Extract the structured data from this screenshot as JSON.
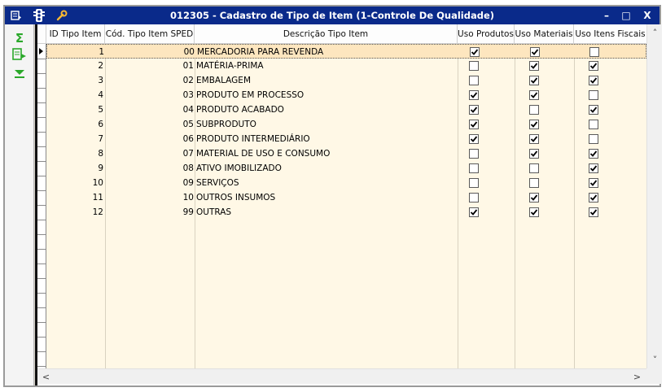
{
  "window": {
    "title": "012305 - Cadastro de Tipo de Item (1-Controle De Qualidade)",
    "minimize_glyph": "–",
    "maximize_glyph": "□",
    "close_glyph": "X"
  },
  "colors": {
    "titlebar": "#0a2a8a",
    "grid_body": "#fff8e6",
    "selected_row": "#fde6bf",
    "toolbar_icon": "#2aa82a"
  },
  "toolbar": {
    "icons": [
      "menu-icon",
      "traffic-light-icon",
      "wrench-icon"
    ],
    "side_icons": [
      "sigma-icon",
      "export-icon",
      "filter-icon"
    ]
  },
  "grid": {
    "columns": [
      "ID Tipo Item",
      "Cód. Tipo Item SPED",
      "Descrição Tipo Item",
      "Uso Produtos",
      "Uso Materiais",
      "Uso Itens Fiscais"
    ],
    "rows": [
      {
        "id": "1",
        "sped": "00",
        "desc": "MERCADORIA PARA REVENDA",
        "produtos": true,
        "materiais": true,
        "fiscais": false
      },
      {
        "id": "2",
        "sped": "01",
        "desc": "MATÉRIA-PRIMA",
        "produtos": false,
        "materiais": true,
        "fiscais": true
      },
      {
        "id": "3",
        "sped": "02",
        "desc": "EMBALAGEM",
        "produtos": false,
        "materiais": true,
        "fiscais": true
      },
      {
        "id": "4",
        "sped": "03",
        "desc": "PRODUTO EM PROCESSO",
        "produtos": true,
        "materiais": true,
        "fiscais": false
      },
      {
        "id": "5",
        "sped": "04",
        "desc": "PRODUTO ACABADO",
        "produtos": true,
        "materiais": false,
        "fiscais": true
      },
      {
        "id": "6",
        "sped": "05",
        "desc": "SUBPRODUTO",
        "produtos": true,
        "materiais": true,
        "fiscais": false
      },
      {
        "id": "7",
        "sped": "06",
        "desc": "PRODUTO INTERMEDIÁRIO",
        "produtos": true,
        "materiais": true,
        "fiscais": false
      },
      {
        "id": "8",
        "sped": "07",
        "desc": "MATERIAL DE USO E CONSUMO",
        "produtos": false,
        "materiais": true,
        "fiscais": true
      },
      {
        "id": "9",
        "sped": "08",
        "desc": "ATIVO IMOBILIZADO",
        "produtos": false,
        "materiais": false,
        "fiscais": true
      },
      {
        "id": "10",
        "sped": "09",
        "desc": "SERVIÇOS",
        "produtos": false,
        "materiais": false,
        "fiscais": true
      },
      {
        "id": "11",
        "sped": "10",
        "desc": "OUTROS INSUMOS",
        "produtos": false,
        "materiais": true,
        "fiscais": true
      },
      {
        "id": "12",
        "sped": "99",
        "desc": "OUTRAS",
        "produtos": true,
        "materiais": true,
        "fiscais": true
      }
    ],
    "selected_row_index": 0,
    "scroll_up_glyph": "˄",
    "scroll_down_glyph": "˅",
    "scroll_left_glyph": "<",
    "scroll_right_glyph": ">"
  }
}
